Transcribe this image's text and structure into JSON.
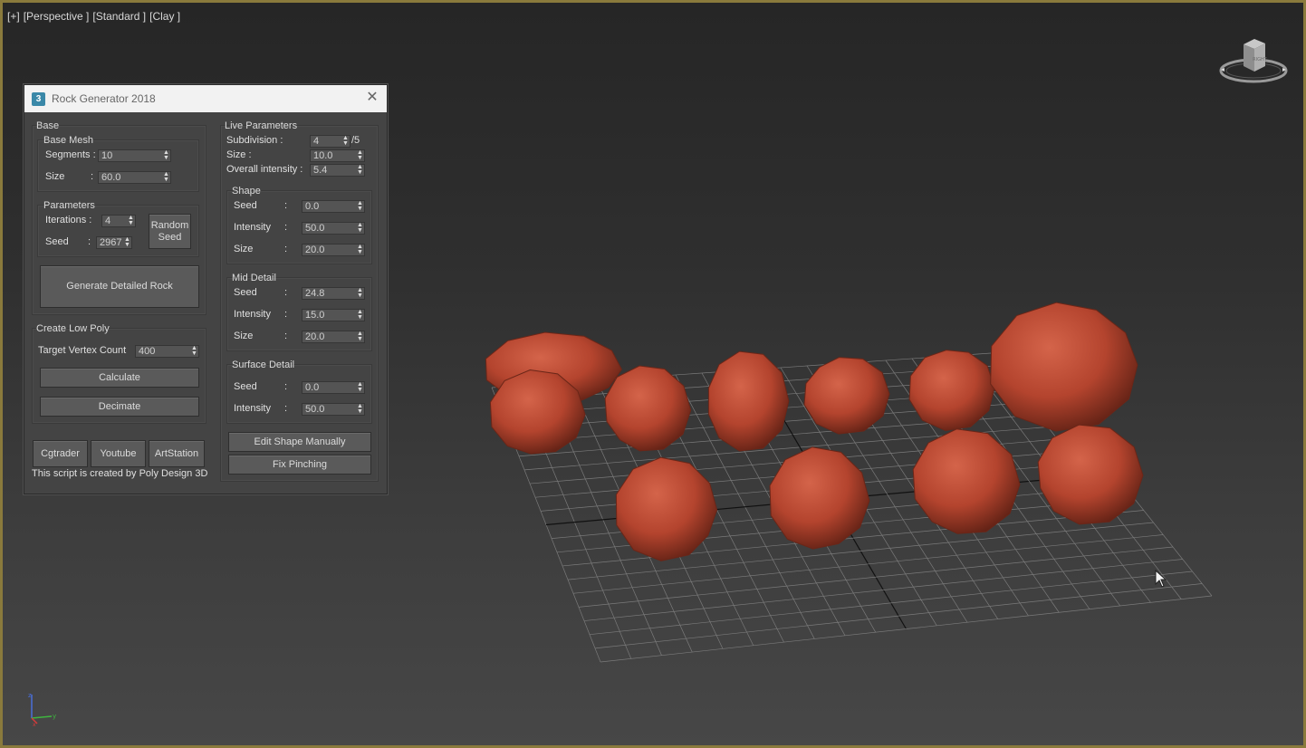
{
  "viewport": {
    "labels": [
      "[+]",
      "[Perspective ]",
      "[Standard ]",
      "[Clay ]"
    ],
    "viewcube_face": "RIGHT",
    "axis_labels": {
      "z": "z",
      "y": "y",
      "x": "x"
    }
  },
  "dialog": {
    "title": "Rock Generator 2018",
    "icon_glyph": "3",
    "base": {
      "label": "Base",
      "base_mesh": {
        "label": "Base Mesh",
        "segments_label": "Segments :",
        "segments_value": "10",
        "size_label": "Size",
        "size_colon": ":",
        "size_value": "60.0"
      },
      "parameters": {
        "label": "Parameters",
        "iterations_label": "Iterations :",
        "iterations_value": "4",
        "seed_label": "Seed",
        "seed_colon": ":",
        "seed_value": "2967",
        "random_seed_line1": "Random",
        "random_seed_line2": "Seed"
      },
      "generate_label": "Generate Detailed Rock"
    },
    "low_poly": {
      "label": "Create Low Poly",
      "target_label": "Target Vertex Count",
      "target_value": "400",
      "calculate_label": "Calculate",
      "decimate_label": "Decimate"
    },
    "links": {
      "cgtrader": "Cgtrader",
      "youtube": "Youtube",
      "artstation": "ArtStation"
    },
    "credit": "This script is created by Poly Design 3D",
    "live": {
      "label": "Live Parameters",
      "subdivision_label": "Subdivision :",
      "subdivision_value": "4",
      "subdivision_max": "/5",
      "size_label": "Size :",
      "size_value": "10.0",
      "intensity_label": "Overall intensity :",
      "intensity_value": "5.4",
      "shape": {
        "label": "Shape",
        "seed_label": "Seed",
        "seed_value": "0.0",
        "intensity_label": "Intensity",
        "intensity_value": "50.0",
        "size_label": "Size",
        "size_value": "20.0"
      },
      "mid": {
        "label": "Mid Detail",
        "seed_label": "Seed",
        "seed_value": "24.8",
        "intensity_label": "Intensity",
        "intensity_value": "15.0",
        "size_label": "Size",
        "size_value": "20.0"
      },
      "surface": {
        "label": "Surface Detail",
        "seed_label": "Seed",
        "seed_value": "0.0",
        "intensity_label": "Intensity",
        "intensity_value": "50.0"
      },
      "colon": ":",
      "edit_label": "Edit Shape Manually",
      "fix_label": "Fix Pinching"
    }
  },
  "colors": {
    "viewport_border": "#8a7a3c",
    "rock": "#b4442e",
    "panel": "#444444",
    "grid": "#7a7a7a"
  }
}
